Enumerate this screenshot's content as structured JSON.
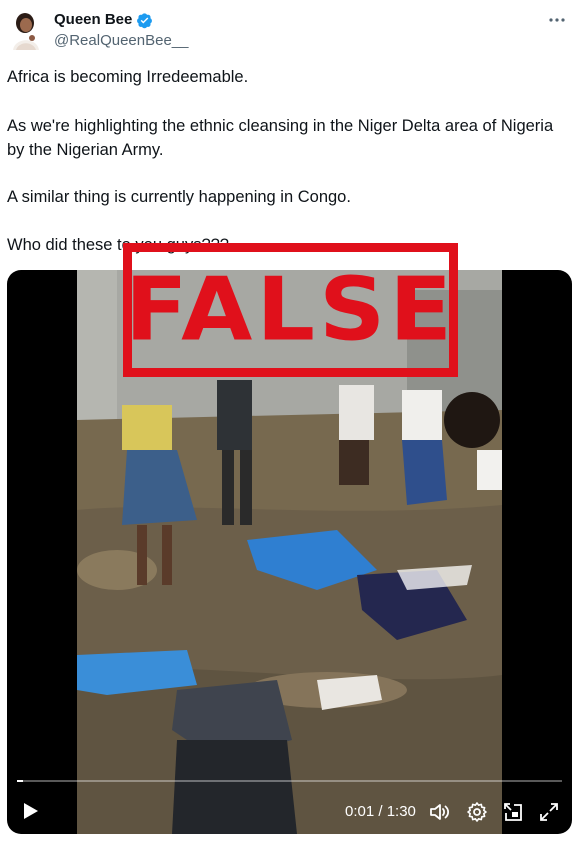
{
  "author": {
    "display_name": "Queen Bee",
    "handle": "@RealQueenBee__",
    "verified": true
  },
  "tweet": {
    "paragraphs": [
      "Africa is becoming Irredeemable.",
      "As we're highlighting the ethnic cleansing in the Niger Delta area of Nigeria by the Nigerian Army.",
      "A similar thing is currently happening in Congo.",
      "Who did these to you guys???"
    ]
  },
  "stamp": {
    "text": "FALSE",
    "color": "#e0101b"
  },
  "video": {
    "time_display": "0:01 / 1:30",
    "progress": 0.011
  },
  "colors": {
    "text_primary": "#0f1419",
    "text_secondary": "#536471",
    "verified_blue": "#1d9bf0",
    "video_bg": "#000000"
  },
  "icons": {
    "more": "more-icon",
    "verified": "verified-badge-icon",
    "play": "play-icon",
    "volume": "volume-icon",
    "settings": "settings-icon",
    "pip": "picture-in-picture-icon",
    "fullscreen": "fullscreen-icon"
  }
}
